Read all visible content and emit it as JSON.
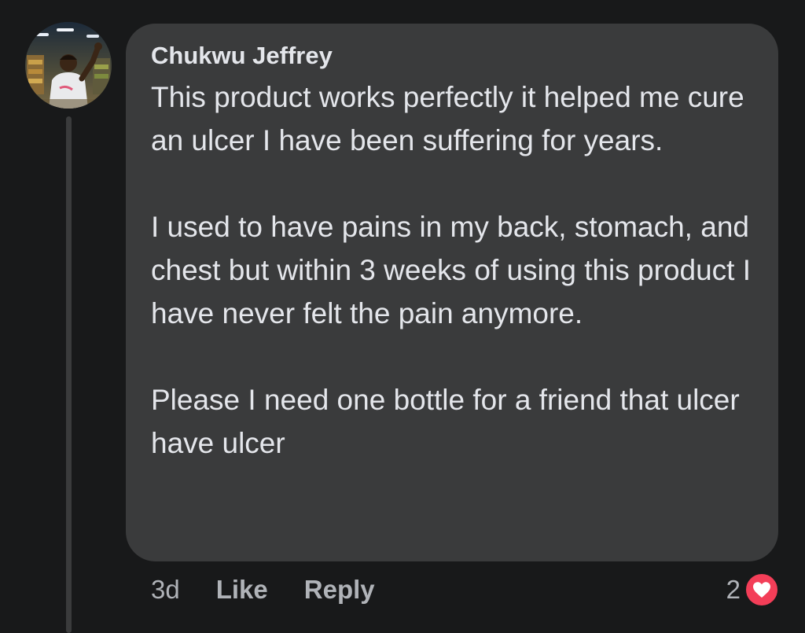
{
  "comment": {
    "author": "Chukwu Jeffrey",
    "paragraphs": [
      "This product works perfectly it helped me cure an ulcer I have been suffering for years.",
      "I used to have pains in my back, stomach, and chest but within 3 weeks of using this product I have never felt the pain anymore.",
      "Please I need one bottle for a friend that ulcer have ulcer"
    ],
    "time": "3d",
    "like_label": "Like",
    "reply_label": "Reply",
    "reaction_count": "2",
    "reaction_icon": "heart-icon",
    "colors": {
      "background": "#18191a",
      "bubble": "#3a3b3c",
      "text": "#e4e6eb",
      "muted": "#b0b3b8",
      "heart": "#f33e58"
    }
  }
}
